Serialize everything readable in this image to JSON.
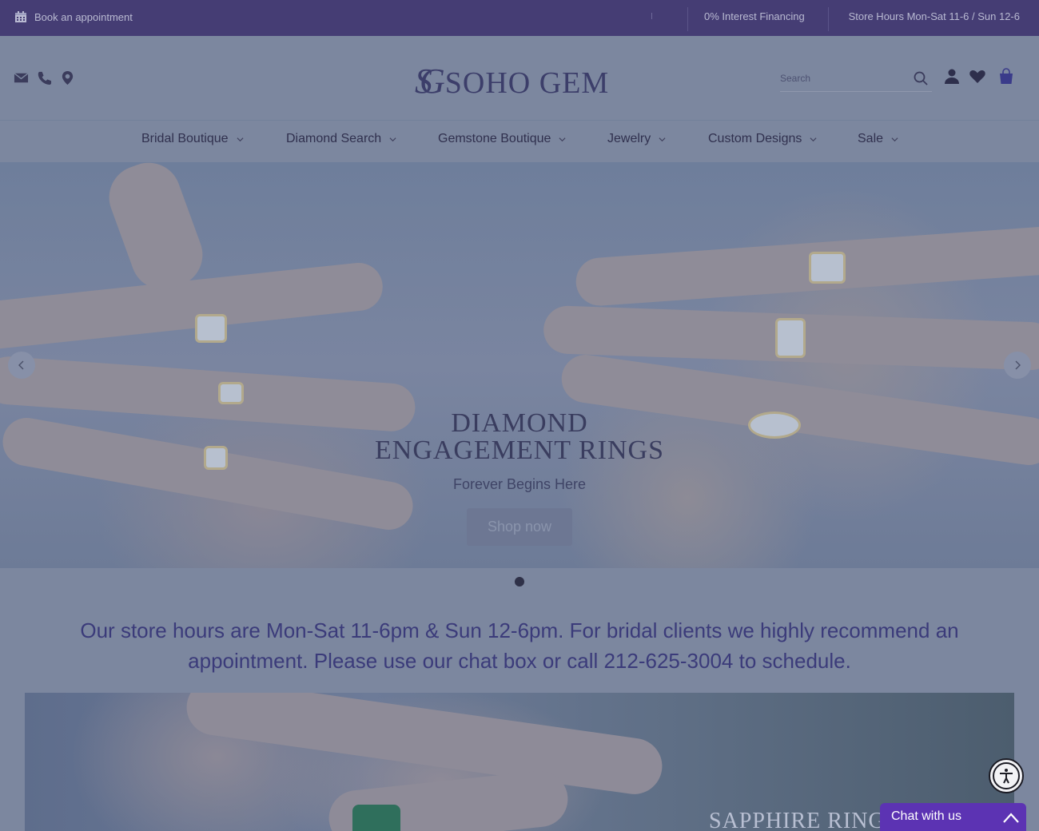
{
  "topbar": {
    "appointment": "Book an appointment",
    "financing": "0% Interest Financing",
    "hours": "Store Hours Mon-Sat 11-6 / Sun 12-6"
  },
  "header": {
    "logo_mark": "SG",
    "logo_name": "SOHO GEM",
    "search_placeholder": "Search"
  },
  "nav": {
    "items": [
      {
        "label": "Bridal Boutique"
      },
      {
        "label": "Diamond Search"
      },
      {
        "label": "Gemstone Boutique"
      },
      {
        "label": "Jewelry"
      },
      {
        "label": "Custom Designs"
      },
      {
        "label": "Sale"
      }
    ]
  },
  "hero": {
    "title_line1": "DIAMOND",
    "title_line2": "ENGAGEMENT RINGS",
    "subtitle": "Forever Begins Here",
    "button": "Shop now"
  },
  "notice": {
    "text": "Our store hours are Mon-Sat 11-6pm & Sun 12-6pm. For bridal clients we highly recommend an appointment. Please use our chat box or call 212-625-3004 to schedule."
  },
  "promo": {
    "title": "SAPPHIRE RINGS"
  },
  "chat": {
    "label": "Chat with us"
  },
  "colors": {
    "topbar": "#453d74",
    "notice_text": "#3b3b7a",
    "chat_button": "#5c33b3"
  }
}
